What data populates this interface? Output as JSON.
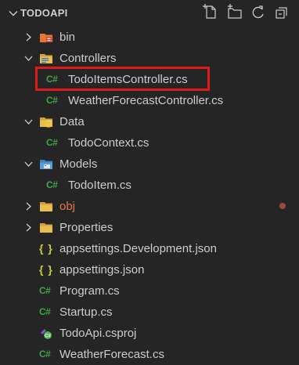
{
  "explorer": {
    "title": "TODOAPI",
    "actions": [
      "new-file-icon",
      "new-folder-icon",
      "refresh-icon",
      "collapse-all-icon"
    ]
  },
  "tree": {
    "bin": "bin",
    "controllers": "Controllers",
    "todo_items_controller": "TodoItemsController.cs",
    "weather_forecast_controller": "WeatherForecastController.cs",
    "data": "Data",
    "todo_context": "TodoContext.cs",
    "models": "Models",
    "todo_item": "TodoItem.cs",
    "obj": "obj",
    "properties": "Properties",
    "appsettings_dev": "appsettings.Development.json",
    "appsettings": "appsettings.json",
    "program": "Program.cs",
    "startup": "Startup.cs",
    "csproj": "TodoApi.csproj",
    "weather_forecast": "WeatherForecast.cs"
  },
  "icons": {
    "csharp": "C#",
    "json": "{ }"
  },
  "colors": {
    "background": "#252526",
    "text": "#cccccc",
    "csharp_icon": "#3fa448",
    "json_icon": "#cbcb41",
    "folder": "#e2b53e",
    "obj_label": "#e2744c",
    "selection_border": "#e0191c"
  }
}
